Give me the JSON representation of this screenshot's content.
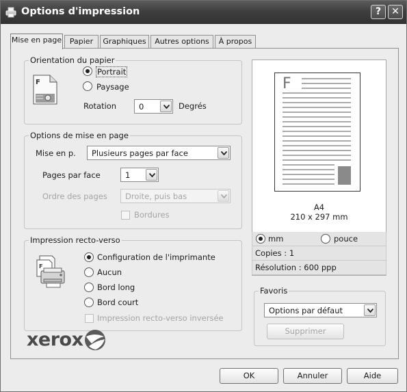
{
  "window": {
    "title": "Options d'impression",
    "help_glyph": "?",
    "close_glyph": "✕",
    "app_icon": "printer-icon"
  },
  "tabs": [
    {
      "label": "Mise en page",
      "active": true
    },
    {
      "label": "Papier",
      "active": false
    },
    {
      "label": "Graphiques",
      "active": false
    },
    {
      "label": "Autres options",
      "active": false
    },
    {
      "label": "À propos",
      "active": false
    }
  ],
  "orientation": {
    "legend": "Orientation du papier",
    "portrait": "Portrait",
    "paysage": "Paysage",
    "selected": "Portrait",
    "rotation_label": "Rotation",
    "rotation_value": "0",
    "degres_label": "Degrés"
  },
  "layout_options": {
    "legend": "Options de mise en page",
    "mise_en_p_label": "Mise en p.",
    "mise_en_p_value": "Plusieurs pages par face",
    "pages_par_face_label": "Pages par face",
    "pages_par_face_value": "1",
    "ordre_label": "Ordre des pages",
    "ordre_value": "Droite, puis bas",
    "bordures_label": "Bordures"
  },
  "duplex": {
    "legend": "Impression recto-verso",
    "options": [
      "Configuration de l'imprimante",
      "Aucun",
      "Bord long",
      "Bord court"
    ],
    "selected": "Configuration de l'imprimante",
    "inverse_label": "Impression recto-verso inversée"
  },
  "preview": {
    "page_letter": "F",
    "paper_name": "A4",
    "paper_size": "210 x 297 mm",
    "unit_mm": "mm",
    "unit_pouce": "pouce",
    "unit_selected": "mm",
    "copies": "Copies : 1",
    "resolution": "Résolution : 600 ppp",
    "accent": "#8a8a8a"
  },
  "favoris": {
    "legend": "Favoris",
    "value": "Options par défaut",
    "delete_label": "Supprimer"
  },
  "brand": {
    "logo_text": "xerox",
    "logo_icon": "xerox-sphere-icon"
  },
  "footer": {
    "ok": "OK",
    "cancel": "Annuler",
    "help": "Aide"
  },
  "colors": {
    "titlebar": "#3f3f3f",
    "dialog_bg": "#ececec"
  }
}
